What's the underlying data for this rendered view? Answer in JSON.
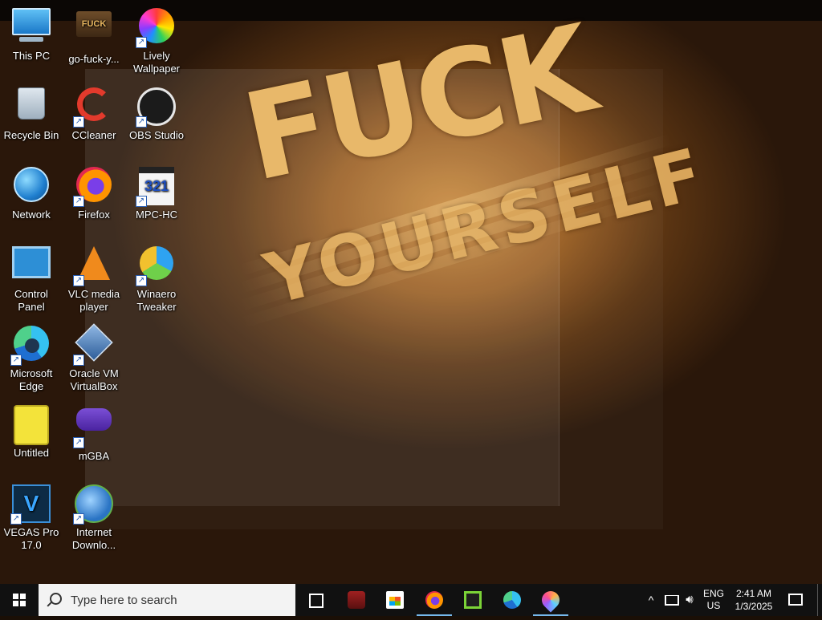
{
  "wallpaper": {
    "line1": "FUCK",
    "line2": "YOURSELF"
  },
  "desktop_icons": [
    {
      "label": "This PC",
      "icon": "computer-icon"
    },
    {
      "label": "Recycle Bin",
      "icon": "recycle-bin-icon"
    },
    {
      "label": "Network",
      "icon": "network-icon"
    },
    {
      "label": "Control Panel",
      "icon": "control-panel-icon"
    },
    {
      "label": "Microsoft Edge",
      "icon": "edge-icon",
      "shortcut": true
    },
    {
      "label": "Untitled",
      "icon": "spongebob-icon"
    },
    {
      "label": "VEGAS Pro 17.0",
      "icon": "vegas-icon",
      "shortcut": true,
      "badge": "17"
    },
    {
      "label": "go-fuck-y...",
      "icon": "image-file-icon",
      "art": "FUCK"
    },
    {
      "label": "CCleaner",
      "icon": "ccleaner-icon",
      "shortcut": true
    },
    {
      "label": "Firefox",
      "icon": "firefox-icon",
      "shortcut": true
    },
    {
      "label": "VLC media player",
      "icon": "vlc-icon",
      "shortcut": true
    },
    {
      "label": "Oracle VM VirtualBox",
      "icon": "virtualbox-icon",
      "shortcut": true
    },
    {
      "label": "mGBA",
      "icon": "mgba-icon",
      "shortcut": true
    },
    {
      "label": "Internet Downlo...",
      "icon": "idm-icon",
      "shortcut": true
    },
    {
      "label": "Lively Wallpaper",
      "icon": "lively-icon",
      "shortcut": true
    },
    {
      "label": "OBS Studio",
      "icon": "obs-icon",
      "shortcut": true
    },
    {
      "label": "MPC-HC",
      "icon": "mpc-hc-icon",
      "shortcut": true,
      "art": "321"
    },
    {
      "label": "Winaero Tweaker",
      "icon": "winaero-icon",
      "shortcut": true
    }
  ],
  "taskbar": {
    "search_placeholder": "Type here to search",
    "pinned": [
      {
        "name": "task-view",
        "icon": "task-view-icon"
      },
      {
        "name": "car-game",
        "icon": "car-game-icon"
      },
      {
        "name": "microsoft-store",
        "icon": "store-icon"
      },
      {
        "name": "firefox",
        "icon": "firefox-icon",
        "active": true
      },
      {
        "name": "green-app",
        "icon": "green-app-icon"
      },
      {
        "name": "edge",
        "icon": "edge-icon"
      },
      {
        "name": "paint",
        "icon": "paint-icon",
        "active": true
      }
    ],
    "tray": {
      "chevron": "^",
      "lang_line1": "ENG",
      "lang_line2": "US",
      "time": "2:41 AM",
      "date": "1/3/2025"
    }
  },
  "colors": {
    "taskbar_bg": "#111111",
    "active_indicator": "#76b9ed",
    "search_bg": "#f3f3f3"
  }
}
